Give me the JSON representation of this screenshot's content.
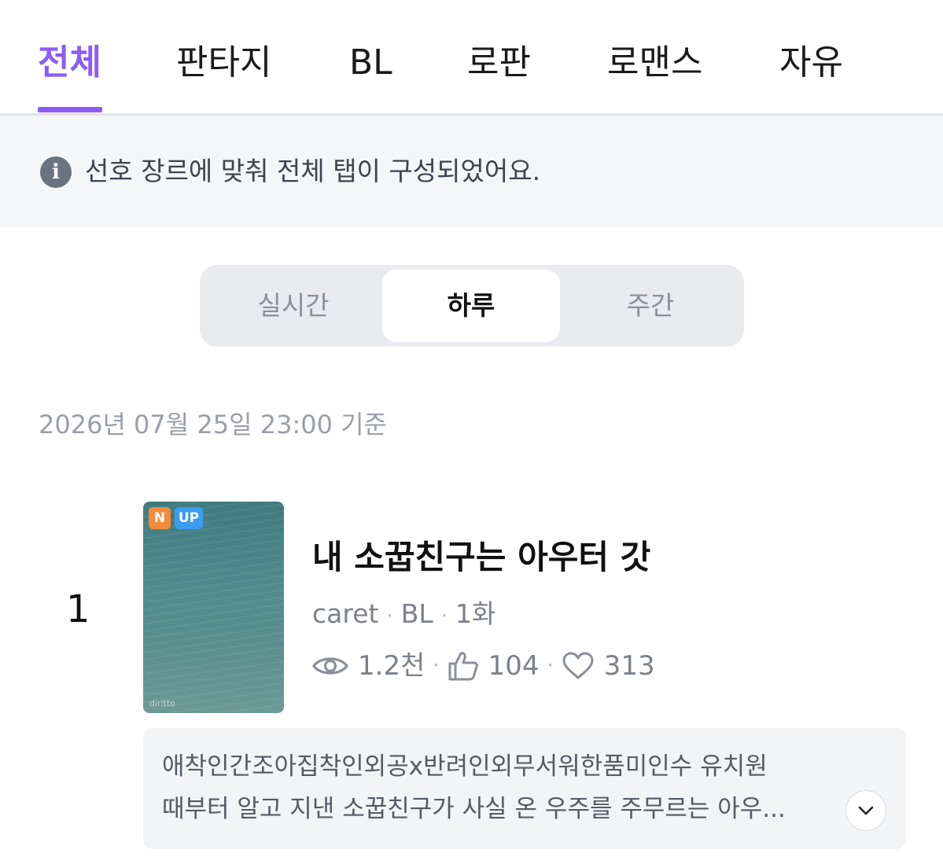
{
  "genre_tabs": [
    {
      "label": "전체",
      "active": true
    },
    {
      "label": "판타지",
      "active": false
    },
    {
      "label": "BL",
      "active": false
    },
    {
      "label": "로판",
      "active": false
    },
    {
      "label": "로맨스",
      "active": false
    },
    {
      "label": "자유",
      "active": false
    }
  ],
  "notice": {
    "icon": "info-icon",
    "text": "선호 장르에 맞춰 전체 탭이 구성되었어요."
  },
  "period": {
    "options": [
      "실시간",
      "하루",
      "주간"
    ],
    "selected": "하루"
  },
  "timestamp": "2026년 07월 25일 23:00 기준",
  "ranking": [
    {
      "rank": "1",
      "badges": [
        "N",
        "UP"
      ],
      "cover_mark": "diritto",
      "title": "내 소꿉친구는 아우터 갓",
      "author": "caret",
      "genre": "BL",
      "episodes": "1화",
      "views": "1.2천",
      "likes": "104",
      "favorites": "313",
      "synopsis_line1": "애착인간조아집착인외공x반려인외무서워한품미인수 유치원",
      "synopsis_line2": "때부터 알고 지낸 소꿉친구가 사실 온 우주를 주무르는 아우..."
    }
  ],
  "colors": {
    "accent": "#8b5cf6",
    "badge_new": "#f28c3a",
    "badge_up": "#3b9cf0"
  }
}
